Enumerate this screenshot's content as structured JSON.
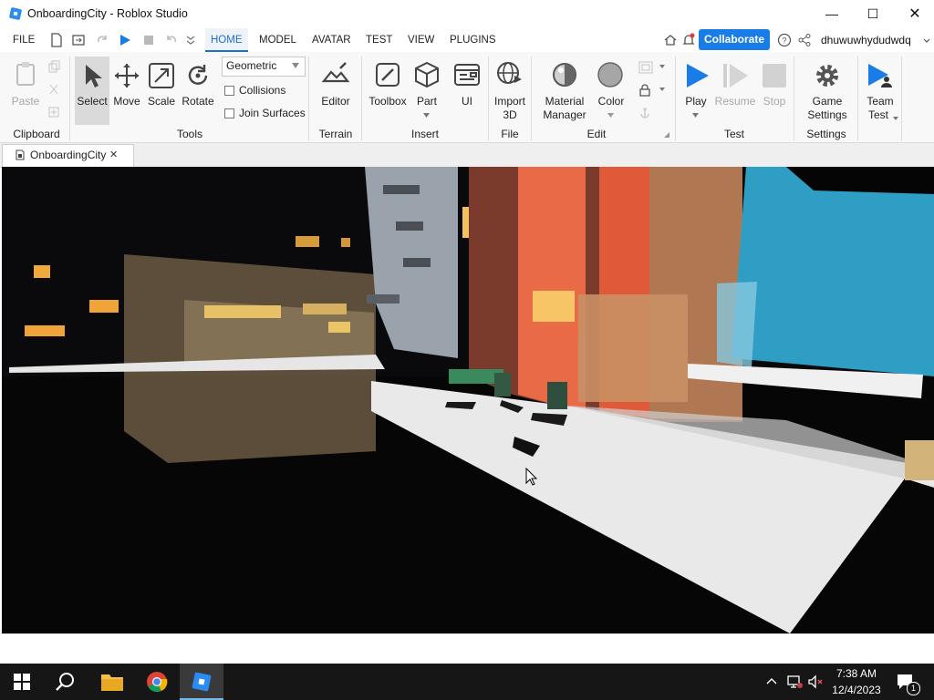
{
  "window": {
    "title": "OnboardingCity - Roblox Studio"
  },
  "menubar": {
    "file_label": "FILE",
    "tabs": [
      "HOME",
      "MODEL",
      "AVATAR",
      "TEST",
      "VIEW",
      "PLUGINS"
    ],
    "active_tab": "HOME",
    "collaborate_label": "Collaborate",
    "username": "dhuwuwhydudwdq"
  },
  "ribbon": {
    "clipboard": {
      "paste_label": "Paste",
      "group_label": "Clipboard"
    },
    "tools": {
      "select_label": "Select",
      "move_label": "Move",
      "scale_label": "Scale",
      "rotate_label": "Rotate",
      "mode_value": "Geometric",
      "collisions_label": "Collisions",
      "join_surfaces_label": "Join Surfaces",
      "group_label": "Tools"
    },
    "terrain": {
      "editor_label": "Editor",
      "group_label": "Terrain"
    },
    "insert": {
      "toolbox_label": "Toolbox",
      "part_label": "Part",
      "ui_label": "UI",
      "group_label": "Insert"
    },
    "file": {
      "import_label_1": "Import",
      "import_label_2": "3D",
      "group_label": "File"
    },
    "edit": {
      "material_label_1": "Material",
      "material_label_2": "Manager",
      "color_label": "Color",
      "group_label": "Edit"
    },
    "test": {
      "play_label": "Play",
      "resume_label": "Resume",
      "stop_label": "Stop",
      "group_label": "Test"
    },
    "settings": {
      "game_label_1": "Game",
      "game_label_2": "Settings",
      "group_label": "Settings"
    },
    "team": {
      "label_1": "Team",
      "label_2": "Test"
    }
  },
  "document_tab": {
    "label": "OnboardingCity",
    "close": "✕"
  },
  "taskbar": {
    "time": "7:38 AM",
    "date": "12/4/2023",
    "notification_count": "1"
  },
  "colors": {
    "accent": "#1a7ce6",
    "play_blue": "#1a7ce6",
    "taskbar": "#161616"
  }
}
